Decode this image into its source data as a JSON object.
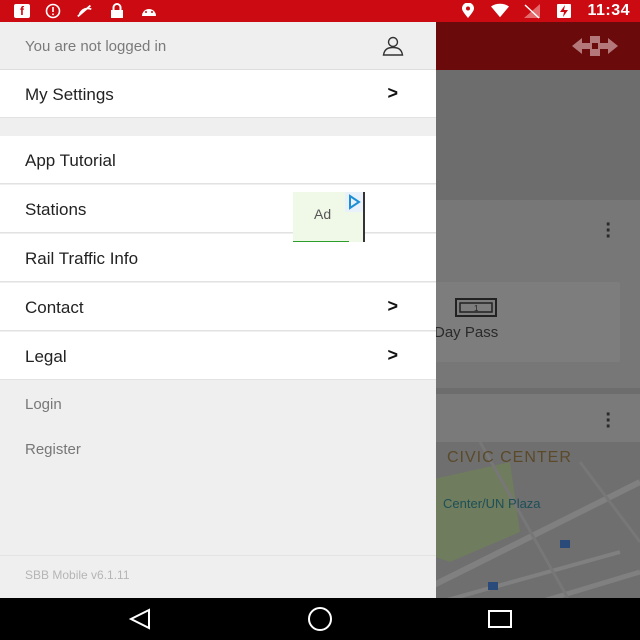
{
  "status_bar": {
    "left_icons": [
      "facebook-icon",
      "alert-icon",
      "no-signal-icon",
      "lock-icon",
      "android-icon"
    ],
    "right_icons": [
      "location-icon",
      "wifi-icon",
      "signal-icon",
      "battery-charging-icon"
    ],
    "time": "11:34"
  },
  "background_app": {
    "logo": "sbb-logo-icon",
    "day_pass_label": "Day Pass",
    "map_title": "CIVIC CENTER",
    "map_plaza": "Center/UN Plaza"
  },
  "drawer": {
    "login_status": "You are not logged in",
    "items": [
      {
        "label": "My Settings",
        "chevron": ">"
      },
      {
        "label": "App Tutorial",
        "chevron": ""
      },
      {
        "label": "Stations",
        "chevron": ""
      },
      {
        "label": "Rail Traffic Info",
        "chevron": ""
      },
      {
        "label": "Contact",
        "chevron": ">"
      },
      {
        "label": "Legal",
        "chevron": ">"
      }
    ],
    "links": {
      "login": "Login",
      "register": "Register"
    },
    "version": "SBB Mobile v6.1.11"
  },
  "ad": {
    "label": "Ad"
  },
  "nav_bar": {
    "buttons": [
      "back-icon",
      "home-icon",
      "recents-icon"
    ]
  }
}
